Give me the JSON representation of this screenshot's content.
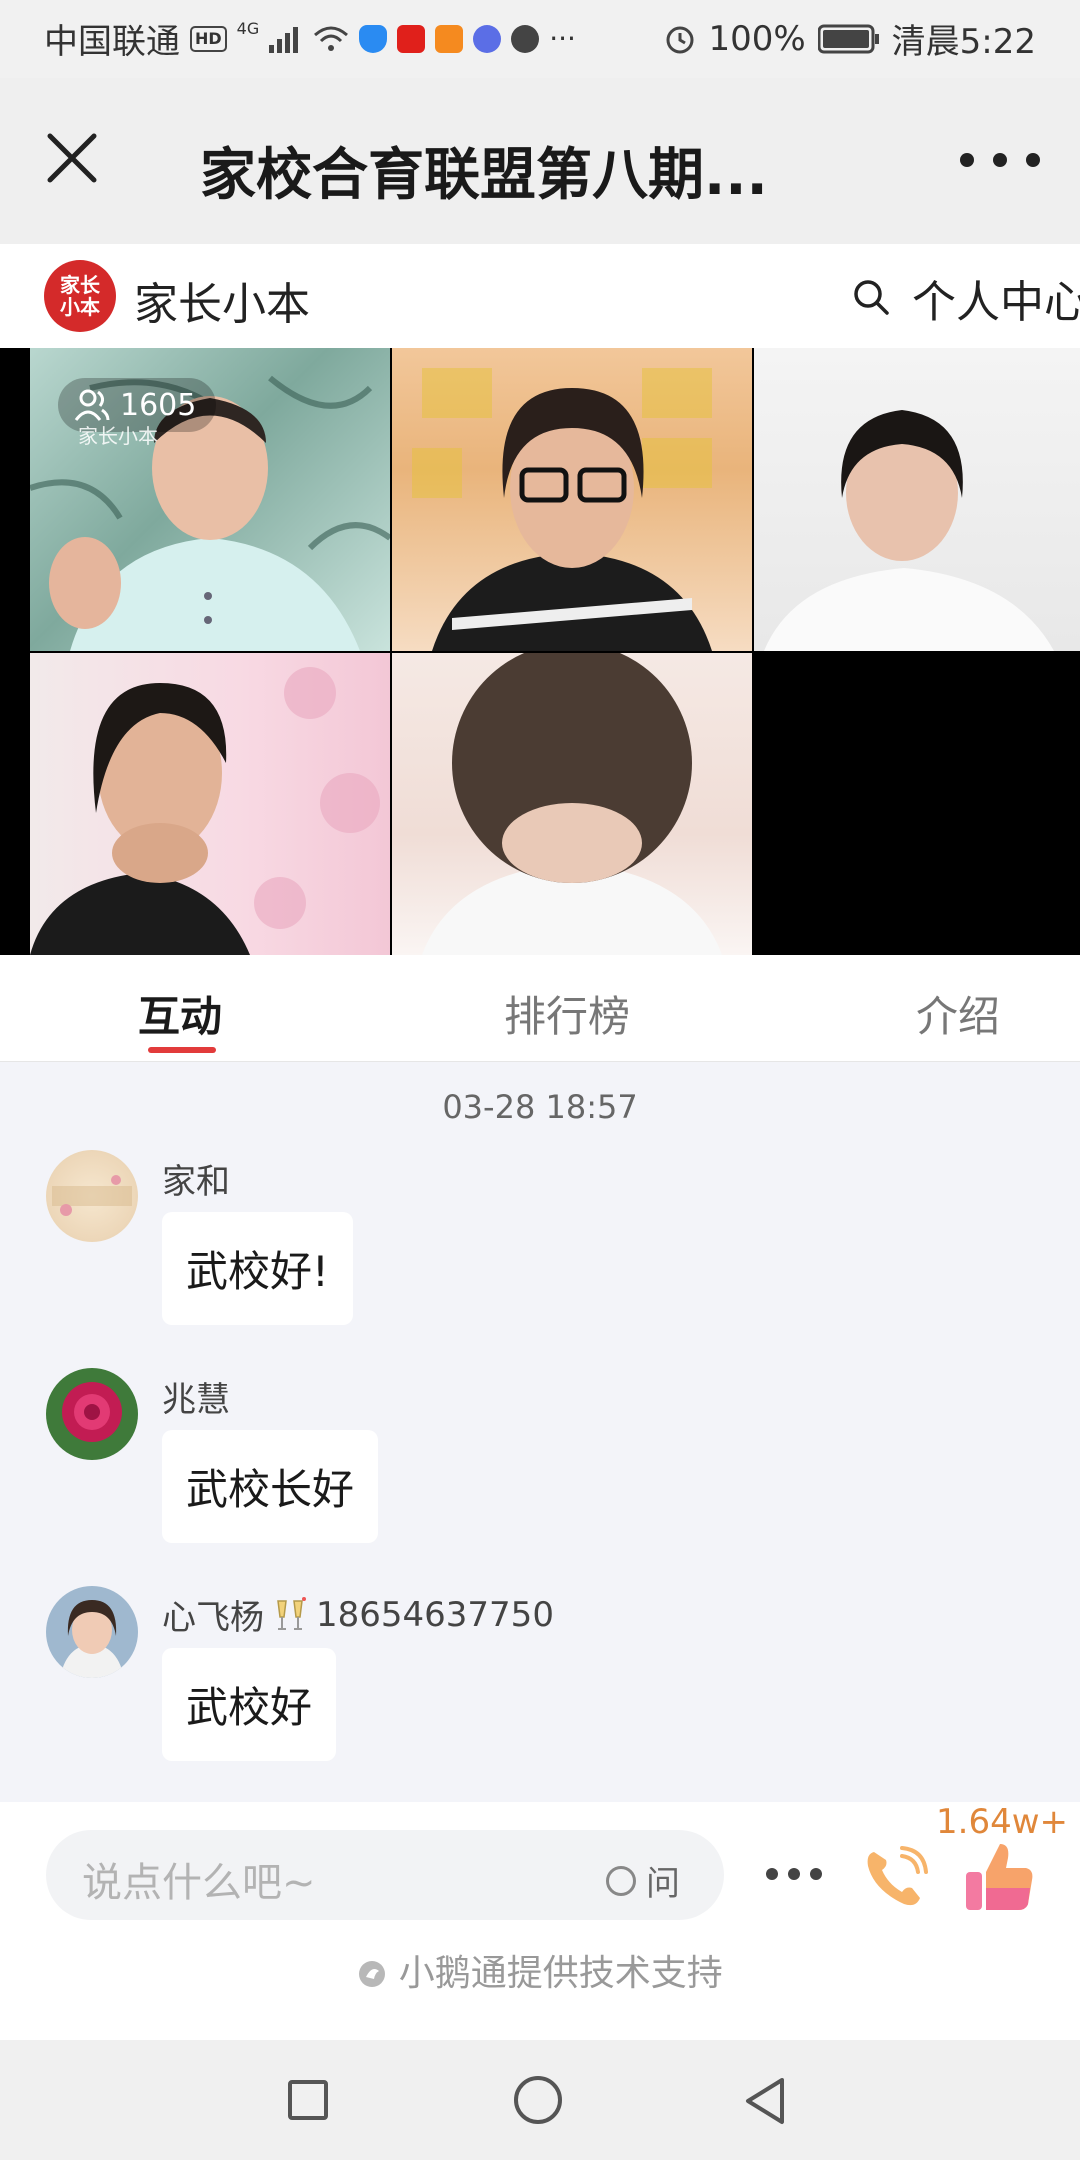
{
  "status_bar": {
    "carrier": "中国联通",
    "hd": "HD",
    "network": "4G",
    "battery": "100%",
    "time": "清晨5:22"
  },
  "title_bar": {
    "title": "家校合育联盟第八期..."
  },
  "app_header": {
    "logo_text": "家长\n小本",
    "app_name": "家长小本",
    "personal_center": "个人中心"
  },
  "video": {
    "viewer_count": "1605",
    "watermark": "家长小本"
  },
  "tabs": [
    {
      "label": "互动",
      "active": true
    },
    {
      "label": "排行榜",
      "active": false
    },
    {
      "label": "介绍",
      "active": false
    }
  ],
  "chat": {
    "timestamp": "03-28 18:57",
    "messages": [
      {
        "name": "家和",
        "text": "武校好!"
      },
      {
        "name": "兆慧",
        "text": "武校长好"
      },
      {
        "name": "心飞杨",
        "name_suffix": "18654637750",
        "text": "武校好"
      }
    ]
  },
  "input_bar": {
    "placeholder": "说点什么吧~",
    "ask_label": "问",
    "like_count": "1.64w+",
    "footer": "小鹅通提供技术支持"
  },
  "colors": {
    "accent_red": "#e23b3b",
    "like_orange": "#e0873a",
    "logo_red": "#d42a2a"
  }
}
